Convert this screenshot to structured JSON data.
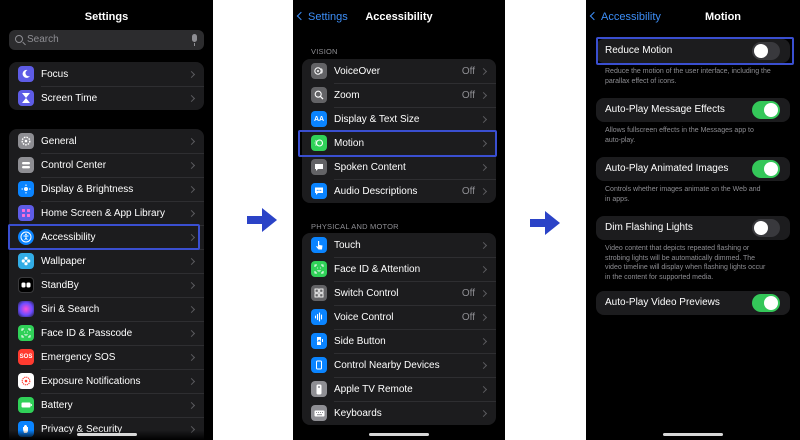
{
  "settings": {
    "title": "Settings",
    "search_placeholder": "Search",
    "group1": [
      {
        "label": "Focus",
        "icon": "moon-icon"
      },
      {
        "label": "Screen Time",
        "icon": "hourglass-icon"
      }
    ],
    "group2": [
      {
        "label": "General",
        "icon": "gear-icon"
      },
      {
        "label": "Control Center",
        "icon": "toggles-icon"
      },
      {
        "label": "Display & Brightness",
        "icon": "sun-icon"
      },
      {
        "label": "Home Screen & App Library",
        "icon": "grid-icon"
      },
      {
        "label": "Accessibility",
        "icon": "accessibility-icon"
      },
      {
        "label": "Wallpaper",
        "icon": "flower-icon"
      },
      {
        "label": "StandBy",
        "icon": "standby-icon"
      },
      {
        "label": "Siri & Search",
        "icon": "siri-icon"
      },
      {
        "label": "Face ID & Passcode",
        "icon": "faceid-icon"
      },
      {
        "label": "Emergency SOS",
        "icon": "sos-icon"
      },
      {
        "label": "Exposure Notifications",
        "icon": "exposure-icon"
      },
      {
        "label": "Battery",
        "icon": "battery-icon"
      },
      {
        "label": "Privacy & Security",
        "icon": "hand-icon"
      }
    ]
  },
  "accessibility": {
    "back": "Settings",
    "title": "Accessibility",
    "vision_header": "VISION",
    "vision": [
      {
        "label": "VoiceOver",
        "value": "Off",
        "icon": "voiceover-icon"
      },
      {
        "label": "Zoom",
        "value": "Off",
        "icon": "zoom-icon"
      },
      {
        "label": "Display & Text Size",
        "value": "",
        "icon": "text-size-icon"
      },
      {
        "label": "Motion",
        "value": "",
        "icon": "motion-icon"
      },
      {
        "label": "Spoken Content",
        "value": "",
        "icon": "speech-icon"
      },
      {
        "label": "Audio Descriptions",
        "value": "Off",
        "icon": "audio-description-icon"
      }
    ],
    "physical_header": "PHYSICAL AND MOTOR",
    "physical": [
      {
        "label": "Touch",
        "value": "",
        "icon": "touch-icon"
      },
      {
        "label": "Face ID & Attention",
        "value": "",
        "icon": "faceid-icon"
      },
      {
        "label": "Switch Control",
        "value": "Off",
        "icon": "switch-control-icon"
      },
      {
        "label": "Voice Control",
        "value": "Off",
        "icon": "voice-control-icon"
      },
      {
        "label": "Side Button",
        "value": "",
        "icon": "side-button-icon"
      },
      {
        "label": "Control Nearby Devices",
        "value": "",
        "icon": "nearby-devices-icon"
      },
      {
        "label": "Apple TV Remote",
        "value": "",
        "icon": "remote-icon"
      },
      {
        "label": "Keyboards",
        "value": "",
        "icon": "keyboard-icon"
      }
    ]
  },
  "motion": {
    "back": "Accessibility",
    "title": "Motion",
    "items": [
      {
        "label": "Reduce Motion",
        "on": false,
        "desc": [
          "Reduce the motion of the user interface, including the",
          "parallax effect of icons."
        ]
      },
      {
        "label": "Auto-Play Message Effects",
        "on": true,
        "desc": [
          "Allows fullscreen effects in the Messages app to",
          "auto-play."
        ]
      },
      {
        "label": "Auto-Play Animated Images",
        "on": true,
        "desc": [
          "Controls whether images animate on the Web and",
          "in apps."
        ]
      },
      {
        "label": "Dim Flashing Lights",
        "on": false,
        "desc": [
          "Video content that depicts repeated flashing or",
          "strobing lights will be automatically dimmed. The",
          "video timeline will display when flashing lights occur",
          "in the content for supported media."
        ]
      },
      {
        "label": "Auto-Play Video Previews",
        "on": true,
        "desc": []
      }
    ]
  },
  "colors": {
    "highlight": "#3a4fd0",
    "arrow": "#2b43c7",
    "toggle_on": "#34c759",
    "link": "#3d8ef7"
  }
}
